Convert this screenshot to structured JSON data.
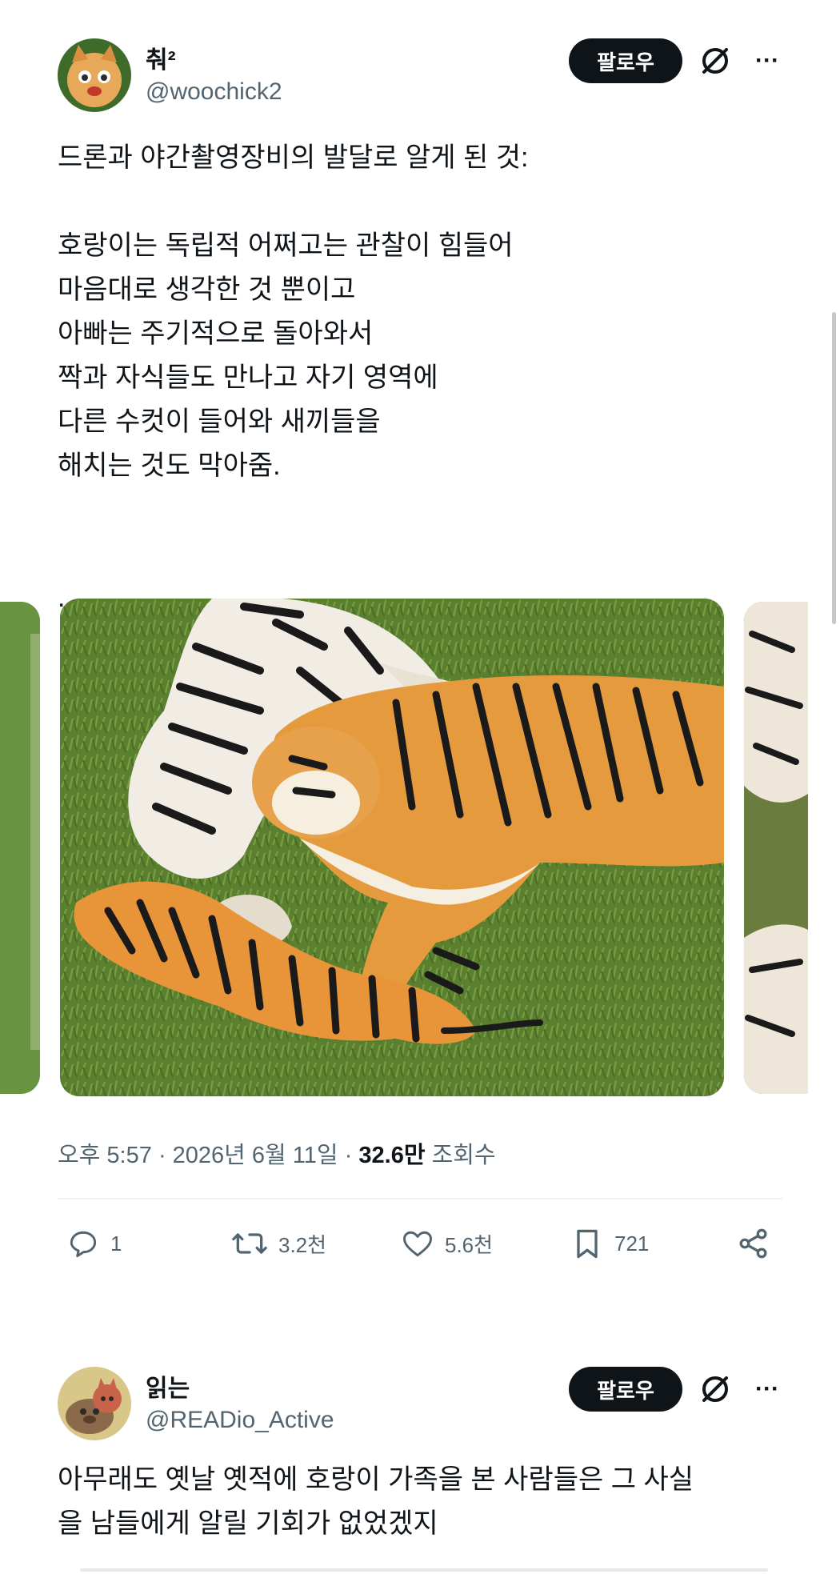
{
  "post": {
    "author_name": "춰²",
    "author_handle": "@woochick2",
    "follow_label": "팔로우",
    "more_label": "···",
    "text": "드론과 야간촬영장비의 발달로 알게 된 것:\n\n호랑이는 독립적 어쩌고는 관찰이 힘들어\n마음대로 생각한 것 뿐이고\n아빠는 주기적으로 돌아와서\n짝과 자식들도 만나고 자기 영역에\n다른 수컷이 들어와 새끼들을\n해치는 것도 막아줌.\n\n\n.",
    "time": "오후 5:57",
    "sep1": "·",
    "date": "2026년 6월 11일",
    "sep2": "·",
    "views_count": "32.6만",
    "views_label": "조회수",
    "actions": {
      "replies": "1",
      "retweets": "3.2천",
      "likes": "5.6천",
      "bookmarks": "721"
    }
  },
  "reply": {
    "author_name": "읽는",
    "author_handle": "@READio_Active",
    "follow_label": "팔로우",
    "more_label": "···",
    "text": "아무래도 옛날 옛적에 호랑이 가족을 본 사람들은 그 사실\n을 남들에게 알릴 기회가 없었겠지"
  },
  "colors": {
    "text": "#0f1419",
    "secondary": "#536471",
    "divider": "#eff3f4",
    "button": "#0f1419"
  },
  "icons": [
    "grok-icon",
    "more-icon",
    "reply-icon",
    "retweet-icon",
    "like-icon",
    "bookmark-icon",
    "share-icon"
  ]
}
